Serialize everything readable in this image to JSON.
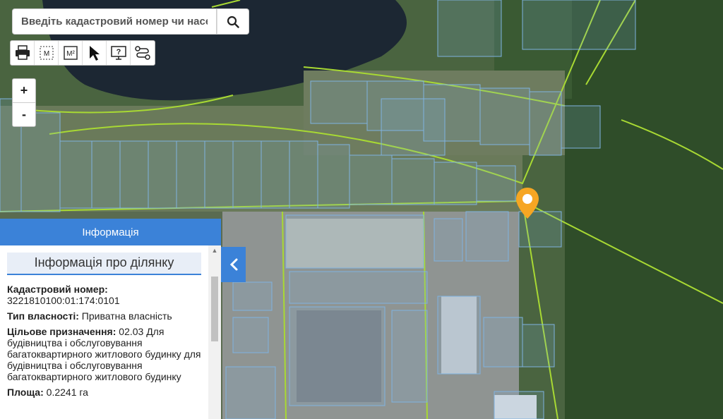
{
  "search": {
    "placeholder": "Введіть кадастровий номер чи населе"
  },
  "toolbar": {
    "tools": [
      {
        "icon": "printer-icon"
      },
      {
        "icon": "measure-distance-icon",
        "label": "M"
      },
      {
        "icon": "measure-area-icon",
        "label": "M²"
      },
      {
        "icon": "cursor-icon"
      },
      {
        "icon": "help-icon",
        "label": "?"
      },
      {
        "icon": "route-icon"
      }
    ]
  },
  "zoom": {
    "in_label": "+",
    "out_label": "-"
  },
  "panel": {
    "header": "Інформація",
    "section_title": "Інформація про ділянку",
    "cadastral_label": "Кадастровий номер:",
    "cadastral_value": "3221810100:01:174:0101",
    "ownership_label": "Тип власності:",
    "ownership_value": "Приватна власність",
    "purpose_label": "Цільове призначення:",
    "purpose_value": "02.03 Для будівництва і обслуговування багатоквартирного житлового будинку для будівництва і обслуговування багатоквартирного житлового будинку",
    "area_label": "Площа:",
    "area_value": "0.2241 га"
  },
  "colors": {
    "accent": "#3b82d8",
    "parcel_border": "#7fb2e0",
    "road_border": "#a8d933",
    "marker": "#f6a623"
  }
}
